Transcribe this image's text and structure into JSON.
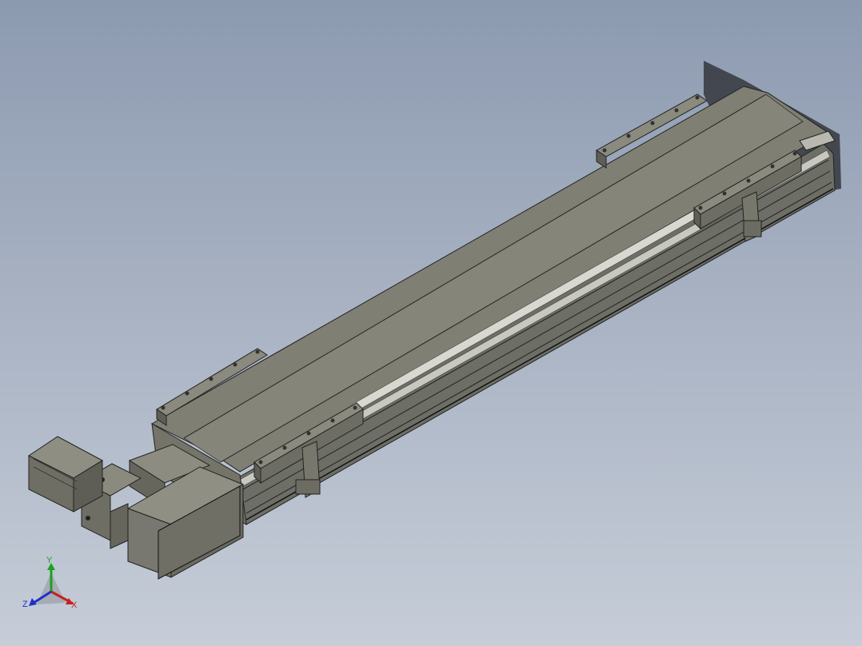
{
  "viewport": {
    "background_top": "#8c9ab0",
    "background_bottom": "#c6cdd8",
    "model_color": "#8a8a7e"
  },
  "triad": {
    "y_label": "Y",
    "x_label": "X",
    "z_label": "Z",
    "x_color": "#c62020",
    "y_color": "#1fa01f",
    "z_color": "#2030c8"
  }
}
